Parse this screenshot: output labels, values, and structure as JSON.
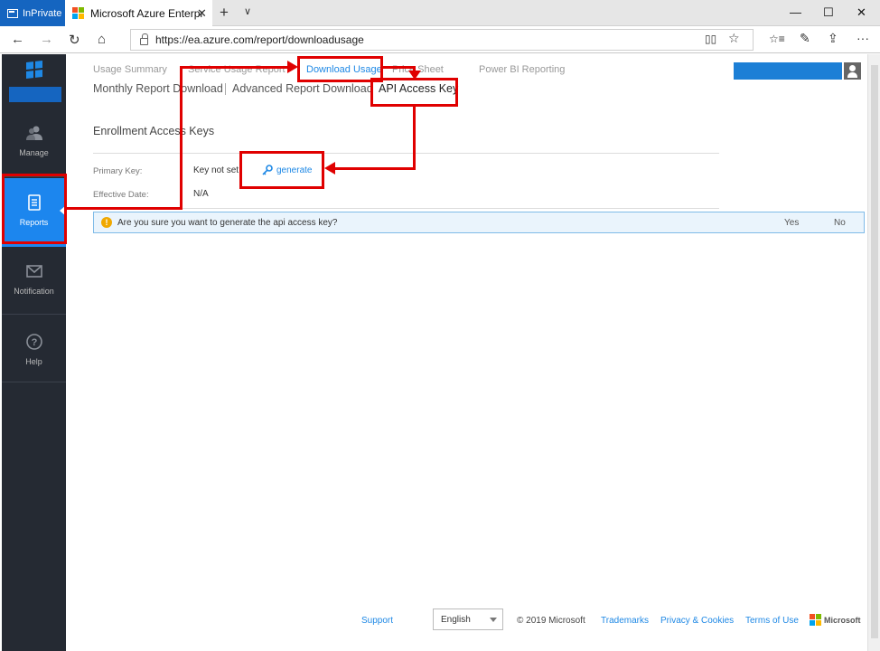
{
  "browser": {
    "inprivate_label": "InPrivate",
    "tab_title": "Microsoft Azure Enterpr",
    "close": "✕",
    "new_tab": "+",
    "tab_list": "∨",
    "minimize": "—",
    "maximize": "☐",
    "close_window": "✕",
    "url": "https://ea.azure.com/report/downloadusage",
    "back": "←",
    "forward": "→",
    "refresh": "↻",
    "home": "⌂",
    "reading_view": "📖",
    "favorite": "☆",
    "favorites_hub": "☆≡",
    "notes": "✎",
    "share": "⇪",
    "more": "···"
  },
  "sidebar": {
    "items": [
      {
        "label": "Manage",
        "icon": "users-icon"
      },
      {
        "label": "Reports",
        "icon": "report-icon"
      },
      {
        "label": "Notification",
        "icon": "mail-icon"
      },
      {
        "label": "Help",
        "icon": "help-icon"
      }
    ],
    "accent": "#1c86ee",
    "background": "#252a33"
  },
  "subnav": {
    "level1": [
      "Usage Summary",
      "Service Usage Report",
      "Download Usage",
      "Price Sheet",
      "Power BI Reporting"
    ],
    "level2": [
      "Monthly Report Download",
      "Advanced Report Download",
      "API Access Key"
    ]
  },
  "keys": {
    "title": "Enrollment Access Keys",
    "primary_key_label": "Primary Key:",
    "primary_key_value": "Key not set",
    "generate_label": "generate",
    "effective_date_label": "Effective Date:",
    "effective_date_value": "N/A"
  },
  "confirm": {
    "icon_text": "!",
    "message": "Are you sure you want to generate the api access key?",
    "yes": "Yes",
    "no": "No"
  },
  "footer": {
    "support": "Support",
    "language": "English",
    "copyright": "© 2019 Microsoft",
    "trademarks": "Trademarks",
    "privacy": "Privacy & Cookies",
    "terms": "Terms of Use",
    "microsoft": "Microsoft"
  },
  "colors": {
    "annotation": "#e00000",
    "link": "#1e88e5",
    "inprivate": "#1565c0"
  }
}
